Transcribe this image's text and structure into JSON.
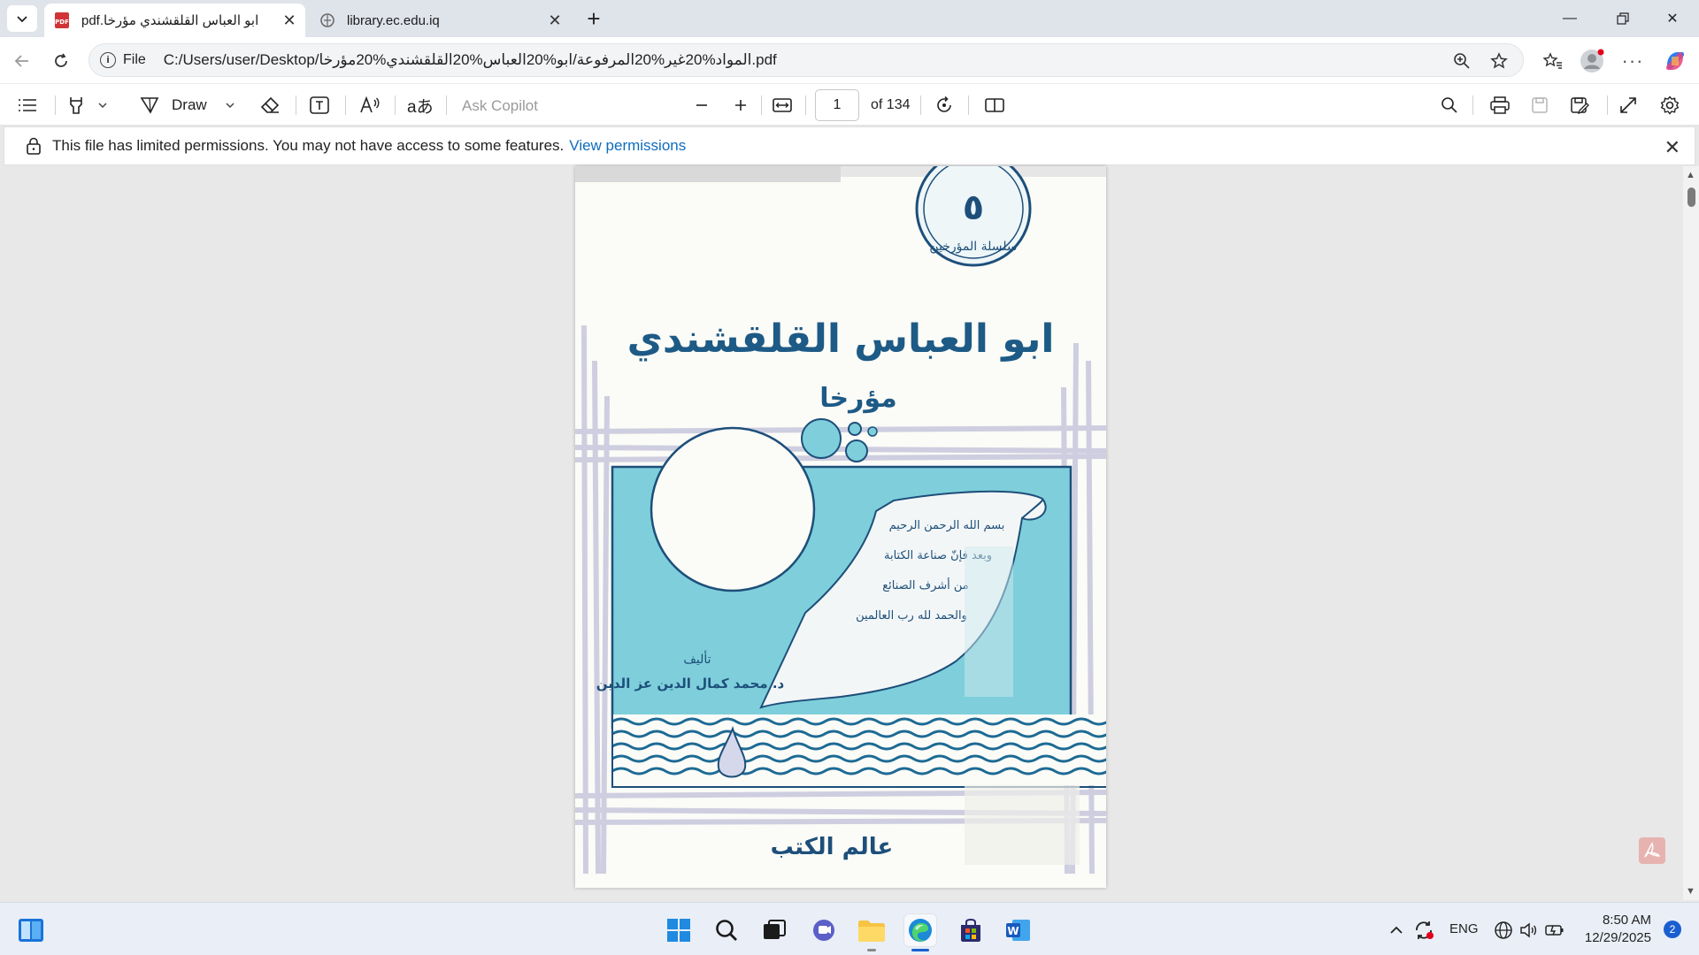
{
  "tabs": [
    {
      "title": "pdf.ابو العباس القلقشندي مؤرخا",
      "icon": "pdf-file-icon",
      "active": true
    },
    {
      "title": "library.ec.edu.iq",
      "icon": "web-page-icon",
      "active": false
    }
  ],
  "address_bar": {
    "scheme_label": "File",
    "url": "C:/Users/user/Desktop/المواد%20غير%20المرفوعة/ابو%20العباس%20القلقشندي%20مؤرخا.pdf"
  },
  "pdf_toolbar": {
    "draw_label": "Draw",
    "copilot_placeholder": "Ask Copilot",
    "current_page": "1",
    "page_count_label": "of 134"
  },
  "banner": {
    "message": "This file has limited permissions. You may not have access to some features.",
    "link": "View permissions"
  },
  "book_cover": {
    "series_number": "٥",
    "series_label": "سلسلة المؤرخين",
    "title": "ابو العباس القلقشندي",
    "subtitle": "مؤرخا",
    "scroll_text": [
      "بسم الله الرحمن الرحيم",
      "وبعد فإنّ صناعة الكتابة",
      "من أشرف الصنائع",
      "والحمد لله رب العالمين"
    ],
    "author_prefix": "تأليف",
    "author": "د. محمد كمال الدين عز الدين",
    "publisher": "عالم الكتب"
  },
  "taskbar": {
    "lang": "ENG",
    "time": "8:50 AM",
    "date": "12/29/2025",
    "notification_count": "2"
  },
  "colors": {
    "accent": "#0f6cbd",
    "cover_teal": "#7ecfdb",
    "cover_navy": "#1d4f7a"
  }
}
